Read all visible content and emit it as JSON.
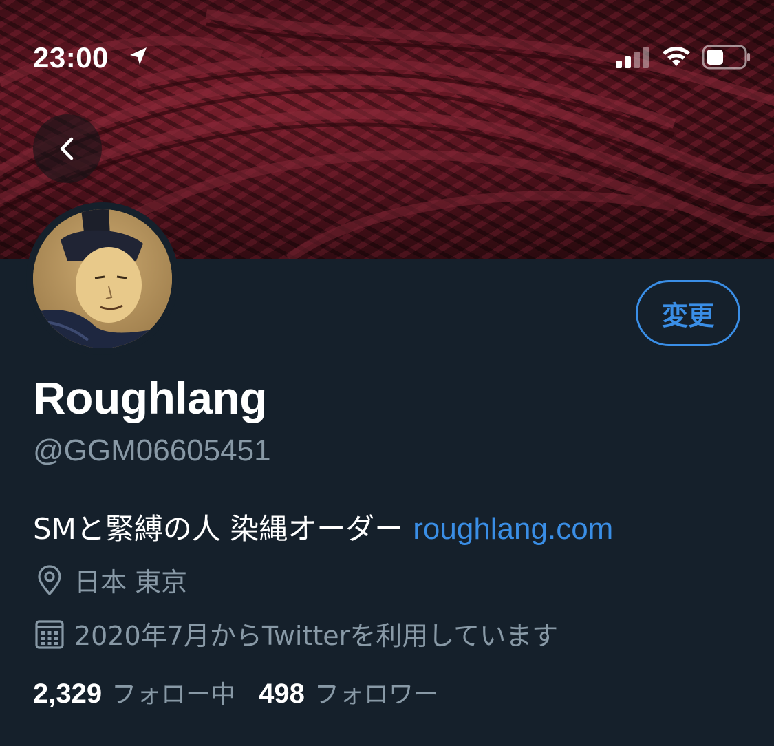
{
  "status_bar": {
    "time": "23:00"
  },
  "profile": {
    "display_name": "Roughlang",
    "handle": "@GGM06605451",
    "bio_text": "SMと緊縛の人 染縄オーダー",
    "bio_link": "roughlang.com",
    "location": "日本 東京",
    "joined": "2020年7月からTwitterを利用しています",
    "edit_label": "変更"
  },
  "stats": {
    "following_count": "2,329",
    "following_label": "フォロー中",
    "followers_count": "498",
    "followers_label": "フォロワー"
  },
  "colors": {
    "background": "#15202b",
    "accent": "#3a8ee6",
    "secondary_text": "#8899a6"
  }
}
